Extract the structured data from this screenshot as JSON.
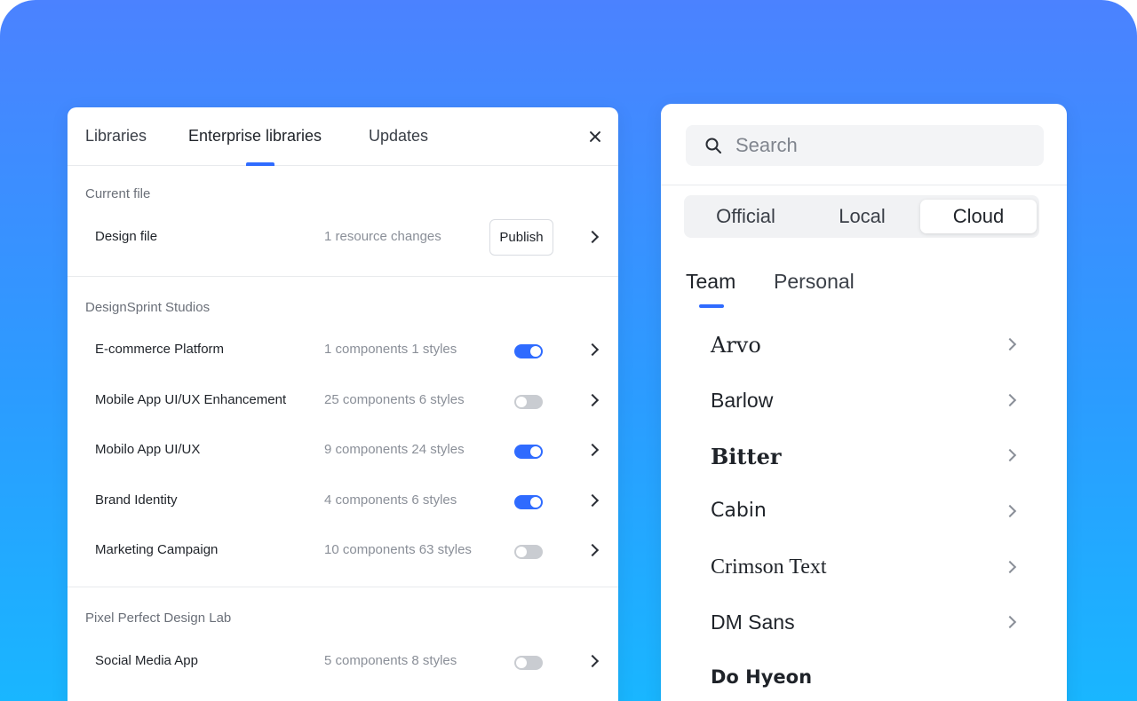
{
  "library_panel": {
    "tabs": [
      {
        "label": "Libraries"
      },
      {
        "label": "Enterprise libraries"
      },
      {
        "label": "Updates"
      }
    ],
    "active_tab": "Enterprise libraries",
    "current_file": {
      "section_label": "Current file",
      "name": "Design file",
      "meta": "1 resource changes",
      "publish_label": "Publish"
    },
    "groups": [
      {
        "label": "DesignSprint Studios",
        "items": [
          {
            "name": "E-commerce Platform",
            "meta": "1 components 1 styles",
            "enabled": true
          },
          {
            "name": "Mobile App UI/UX Enhancement",
            "meta": "25 components 6 styles",
            "enabled": false
          },
          {
            "name": "Mobilo App UI/UX",
            "meta": "9 components 24 styles",
            "enabled": true
          },
          {
            "name": "Brand Identity",
            "meta": "4 components 6 styles",
            "enabled": true
          },
          {
            "name": "Marketing Campaign",
            "meta": "10 components 63 styles",
            "enabled": false
          }
        ]
      },
      {
        "label": "Pixel Perfect Design Lab",
        "items": [
          {
            "name": "Social Media App",
            "meta": "5 components 8 styles",
            "enabled": false
          }
        ]
      }
    ]
  },
  "font_panel": {
    "search": {
      "placeholder": "Search",
      "value": ""
    },
    "segments": [
      {
        "label": "Official"
      },
      {
        "label": "Local"
      },
      {
        "label": "Cloud"
      }
    ],
    "active_segment": "Cloud",
    "sub_tabs": [
      {
        "label": "Team"
      },
      {
        "label": "Personal"
      }
    ],
    "active_sub_tab": "Team",
    "fonts": [
      {
        "name": "Arvo"
      },
      {
        "name": "Barlow"
      },
      {
        "name": "Bitter"
      },
      {
        "name": "Cabin"
      },
      {
        "name": "Crimson Text"
      },
      {
        "name": "DM Sans"
      },
      {
        "name": "Do Hyeon"
      }
    ]
  },
  "colors": {
    "accent": "#2f6bff",
    "background_top": "#4b82ff",
    "background_bottom": "#19b6ff"
  }
}
